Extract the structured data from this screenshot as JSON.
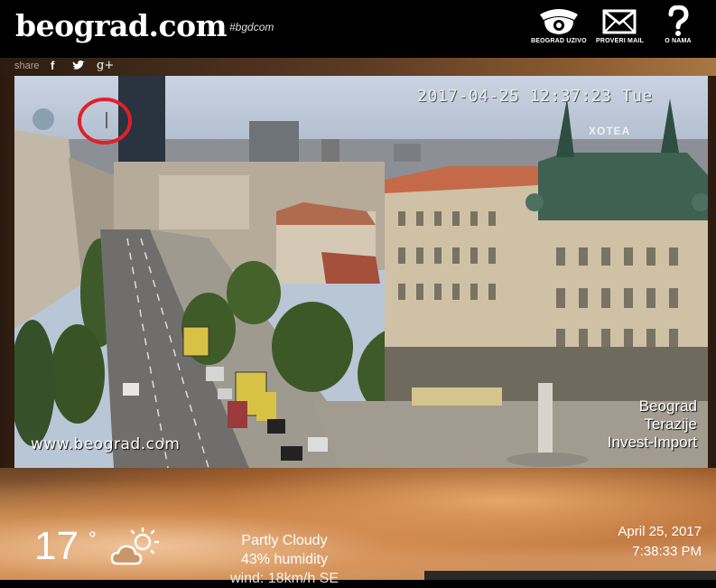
{
  "header": {
    "logo": "beograd.com",
    "hashtag": "#bgdcom",
    "nav": [
      {
        "label": "BEOGRAD UZIVO",
        "icon": "camera-icon"
      },
      {
        "label": "PROVERI MAIL",
        "icon": "mail-icon"
      },
      {
        "label": "O NAMA",
        "icon": "question-icon"
      }
    ]
  },
  "share": {
    "label": "share",
    "icons": [
      {
        "name": "facebook-icon",
        "glyph": "f"
      },
      {
        "name": "twitter-icon",
        "glyph": "🐦"
      },
      {
        "name": "google-plus-icon",
        "glyph": "g+"
      }
    ]
  },
  "camera": {
    "timestamp": "2017-04-25 12:37:23 Tue",
    "watermark": "www.beograd.com",
    "location_lines": [
      "Beograd",
      "Terazije",
      "Invest-Import"
    ],
    "hotel_sign": "XOTEA"
  },
  "weather": {
    "temperature": "17",
    "degree": "°",
    "condition": "Partly Cloudy",
    "humidity": "43% humidity",
    "wind": "wind: 18km/h SE",
    "date": "April 25, 2017",
    "time": "7:38:33 PM",
    "icon": "partly-cloudy-icon"
  }
}
